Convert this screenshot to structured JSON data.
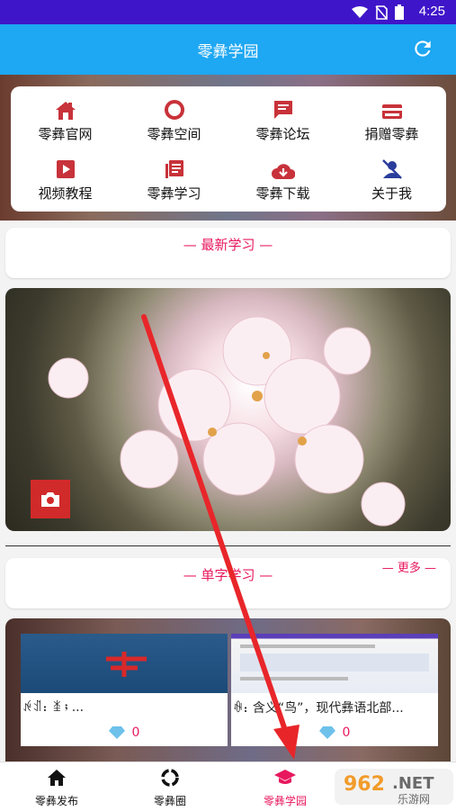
{
  "status": {
    "time": "4:25"
  },
  "header": {
    "title": "零彝学园"
  },
  "menu": {
    "items": [
      {
        "label": "零彝官网",
        "icon": "home-icon"
      },
      {
        "label": "零彝空间",
        "icon": "circle-icon"
      },
      {
        "label": "零彝论坛",
        "icon": "chat-icon"
      },
      {
        "label": "捐赠零彝",
        "icon": "card-icon"
      },
      {
        "label": "视频教程",
        "icon": "video-icon"
      },
      {
        "label": "零彝学习",
        "icon": "book-icon"
      },
      {
        "label": "零彝下载",
        "icon": "cloud-download-icon"
      },
      {
        "label": "关于我",
        "icon": "person-off-icon"
      }
    ]
  },
  "latest": {
    "title": "— 最新学习 —"
  },
  "single": {
    "title": "— 单字学习 —",
    "more": "— 更多 —"
  },
  "words": [
    {
      "text": "ꉌꀊ：ꁧ；...",
      "count": "0"
    },
    {
      "text": "ꊿ：含义“鸟”，现代彝语北部...",
      "count": "0"
    }
  ],
  "nav": {
    "items": [
      {
        "label": "零彝发布"
      },
      {
        "label": "零彝圈"
      },
      {
        "label": "零彝学园"
      },
      {
        "label": ""
      }
    ]
  },
  "watermark": {
    "text": "962.NET",
    "sub": "乐游网"
  },
  "colors": {
    "accent": "#e8185e",
    "appbar": "#1ea7f2",
    "statusbar": "#3f15c9"
  }
}
